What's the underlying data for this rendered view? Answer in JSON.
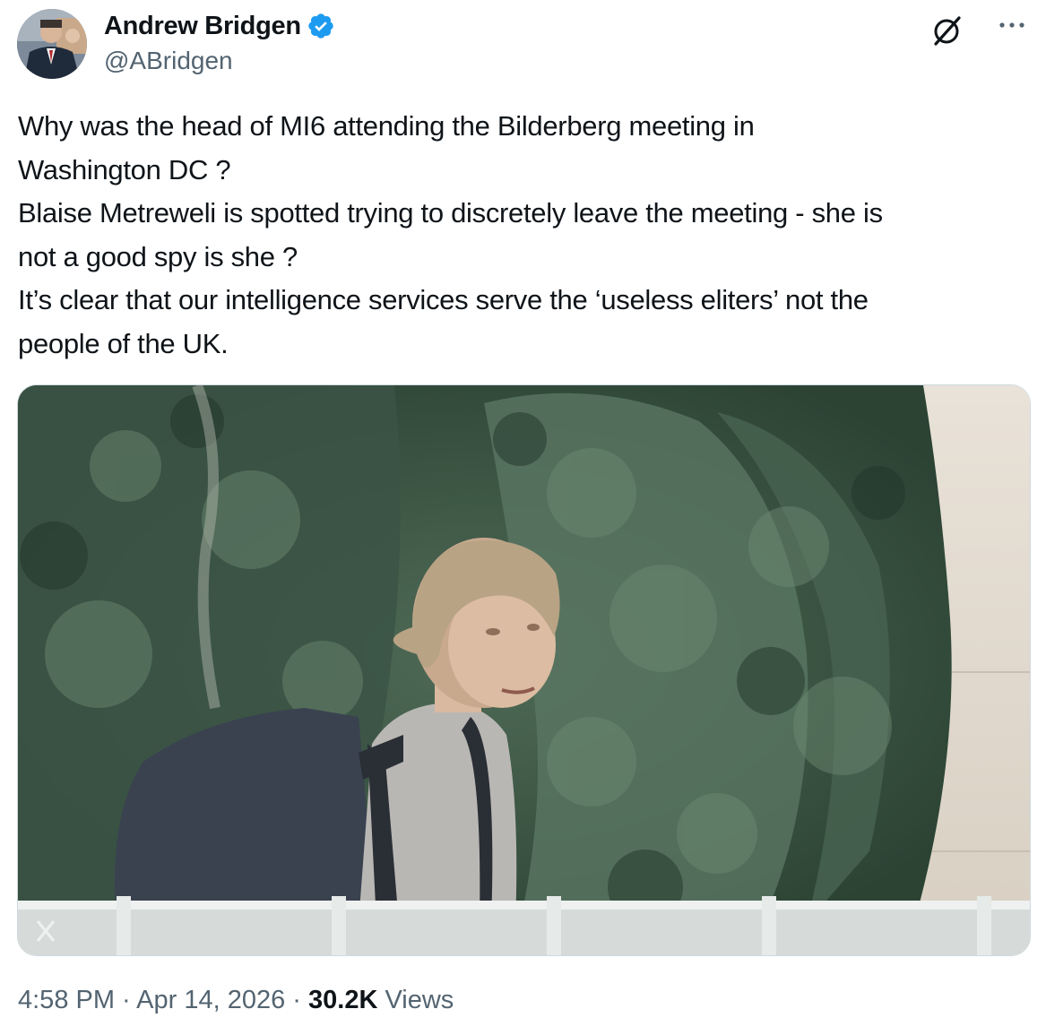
{
  "author": {
    "display_name": "Andrew Bridgen",
    "handle": "@ABridgen",
    "verified": true,
    "verified_color": "#1d9bf0"
  },
  "tweet": {
    "text": "Why was the head of MI6 attending the Bilderberg meeting in\nWashington DC ?\nBlaise Metreweli is spotted trying to discretely leave the meeting - she is\nnot a good spy is she ?\nIt’s clear that our intelligence services serve the ‘useless eliters’ not the\npeople of the UK."
  },
  "meta": {
    "time": "4:58 PM",
    "sep1": " · ",
    "date": "Apr 14, 2026",
    "sep2": " · ",
    "views_count": "30.2K",
    "views_label": " Views"
  },
  "icons": {
    "grok": "grok-icon",
    "more": "more-icon",
    "verified": "verified-badge-icon",
    "watermark": "x-logo-icon"
  }
}
